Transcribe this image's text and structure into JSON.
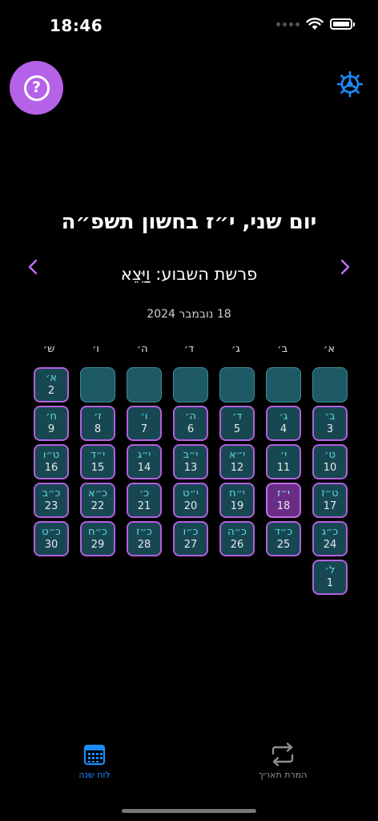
{
  "status_bar": {
    "time": "18:46"
  },
  "header": {
    "help_icon_glyph": "?",
    "hebrew_date": "יום שני, י״ז בחשון תשפ״ה",
    "parasha": "פרשת השבוע: וַיֵּצֵא",
    "gregorian_date": "18 נובמבר 2024"
  },
  "calendar": {
    "weekdays": [
      "א׳",
      "ב׳",
      "ג׳",
      "ד׳",
      "ה׳",
      "ו׳",
      "ש׳"
    ],
    "leading_empty": 6,
    "days": [
      {
        "heb": "א׳",
        "greg": "2"
      },
      {
        "heb": "ב׳",
        "greg": "3"
      },
      {
        "heb": "ג׳",
        "greg": "4"
      },
      {
        "heb": "ד׳",
        "greg": "5"
      },
      {
        "heb": "ה׳",
        "greg": "6"
      },
      {
        "heb": "ו׳",
        "greg": "7"
      },
      {
        "heb": "ז׳",
        "greg": "8"
      },
      {
        "heb": "ח׳",
        "greg": "9"
      },
      {
        "heb": "ט׳",
        "greg": "10"
      },
      {
        "heb": "י׳",
        "greg": "11"
      },
      {
        "heb": "י״א",
        "greg": "12"
      },
      {
        "heb": "י״ב",
        "greg": "13"
      },
      {
        "heb": "י״ג",
        "greg": "14"
      },
      {
        "heb": "י״ד",
        "greg": "15"
      },
      {
        "heb": "ט״ו",
        "greg": "16"
      },
      {
        "heb": "ט״ז",
        "greg": "17"
      },
      {
        "heb": "י״ז",
        "greg": "18"
      },
      {
        "heb": "י״ח",
        "greg": "19"
      },
      {
        "heb": "י״ט",
        "greg": "20"
      },
      {
        "heb": "כ׳",
        "greg": "21"
      },
      {
        "heb": "כ״א",
        "greg": "22"
      },
      {
        "heb": "כ״ב",
        "greg": "23"
      },
      {
        "heb": "כ״ג",
        "greg": "24"
      },
      {
        "heb": "כ״ד",
        "greg": "25"
      },
      {
        "heb": "כ״ה",
        "greg": "26"
      },
      {
        "heb": "כ״ו",
        "greg": "27"
      },
      {
        "heb": "כ״ז",
        "greg": "28"
      },
      {
        "heb": "כ״ח",
        "greg": "29"
      },
      {
        "heb": "כ״ט",
        "greg": "30"
      },
      {
        "heb": "ל׳",
        "greg": "1"
      }
    ],
    "today_index": 16
  },
  "tab_bar": {
    "convert_label": "המרת תאריך",
    "calendar_label": "לוח שנה",
    "active_color": "#1a8cff",
    "inactive_color": "#8e8e93"
  },
  "colors": {
    "accent_purple": "#b561e8",
    "cell_teal": "#174852",
    "hebrew_digit_cyan": "#5fd9e6"
  },
  "icons": {
    "help": "question-circle-icon",
    "settings": "gear-icon",
    "prev": "chevron-left-icon",
    "next": "chevron-right-icon",
    "convert": "arrows-repeat-icon",
    "calendar": "calendar-icon"
  }
}
